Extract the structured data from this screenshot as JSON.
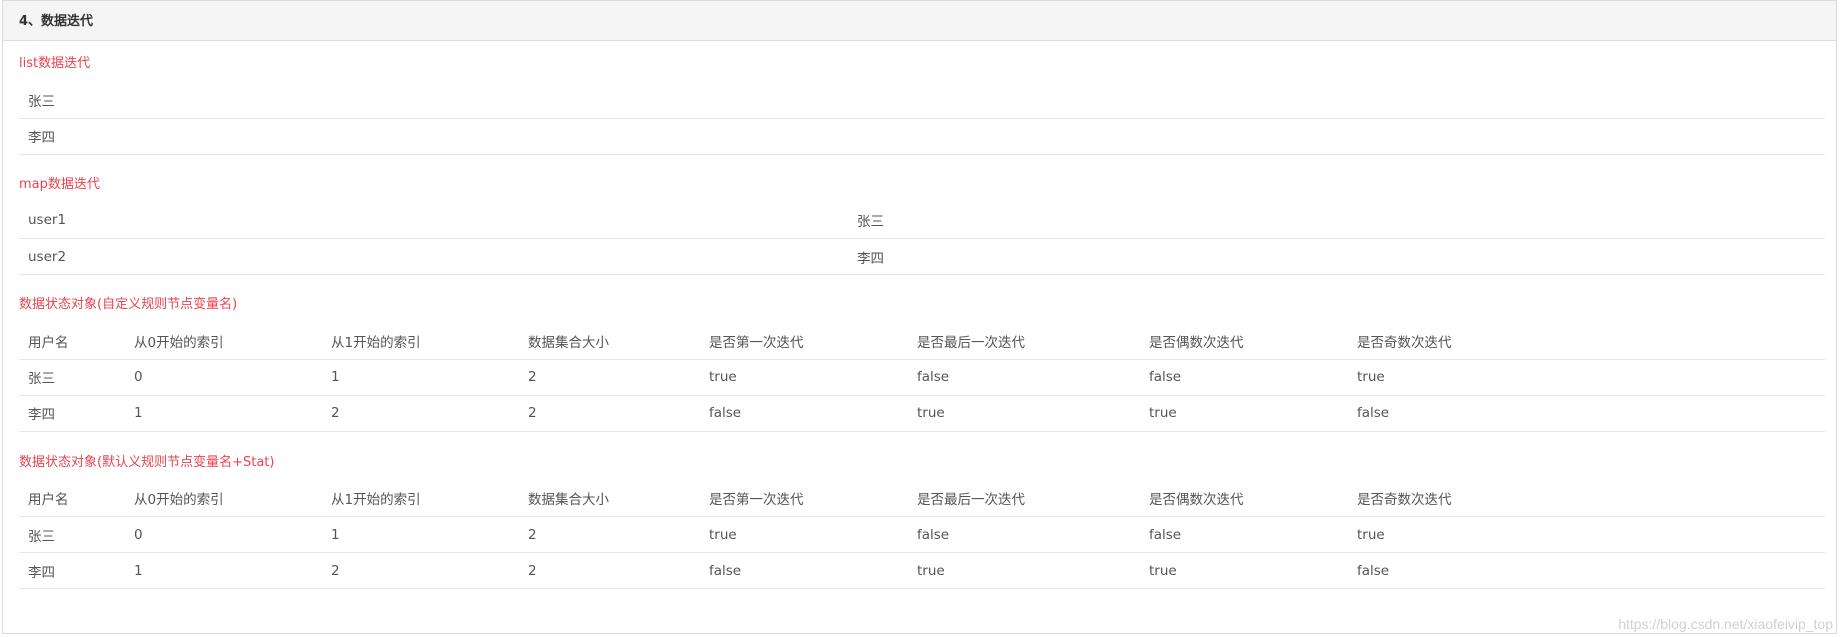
{
  "panel": {
    "title": "4、数据迭代"
  },
  "list_section": {
    "title": "list数据迭代",
    "items": [
      "张三",
      "李四"
    ]
  },
  "map_section": {
    "title": "map数据迭代",
    "rows": [
      {
        "key": "user1",
        "value": "张三"
      },
      {
        "key": "user2",
        "value": "李四"
      }
    ]
  },
  "stat_custom": {
    "title": "数据状态对象(自定义规则节点变量名)",
    "headers": [
      "用户名",
      "从0开始的索引",
      "从1开始的索引",
      "数据集合大小",
      "是否第一次迭代",
      "是否最后一次迭代",
      "是否偶数次迭代",
      "是否奇数次迭代"
    ],
    "rows": [
      [
        "张三",
        "0",
        "1",
        "2",
        "true",
        "false",
        "false",
        "true"
      ],
      [
        "李四",
        "1",
        "2",
        "2",
        "false",
        "true",
        "true",
        "false"
      ]
    ]
  },
  "stat_default": {
    "title": "数据状态对象(默认义规则节点变量名+Stat)",
    "headers": [
      "用户名",
      "从0开始的索引",
      "从1开始的索引",
      "数据集合大小",
      "是否第一次迭代",
      "是否最后一次迭代",
      "是否偶数次迭代",
      "是否奇数次迭代"
    ],
    "rows": [
      [
        "张三",
        "0",
        "1",
        "2",
        "true",
        "false",
        "false",
        "true"
      ],
      [
        "李四",
        "1",
        "2",
        "2",
        "false",
        "true",
        "true",
        "false"
      ]
    ]
  },
  "watermark": "https://blog.csdn.net/xiaofeivip_top",
  "colors": {
    "section_title": "#e9434f",
    "heading_bg": "#f5f5f5",
    "border": "#e8e8e8"
  }
}
